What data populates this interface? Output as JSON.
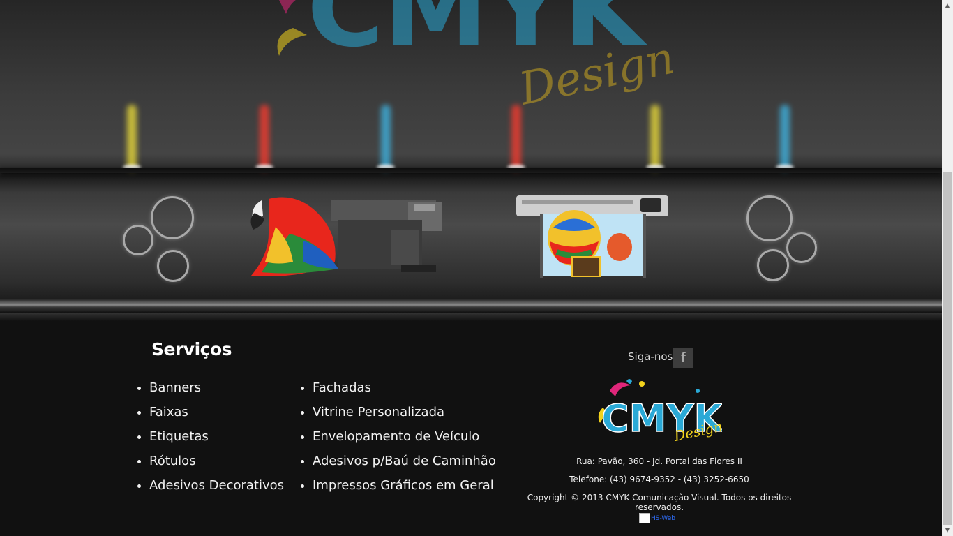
{
  "brand": {
    "wall_logo_text": "CMYK",
    "wall_logo_sub": "Design"
  },
  "services": {
    "title": "Serviços",
    "column1": [
      "Banners",
      "Faixas",
      "Etiquetas",
      "Rótulos",
      "Adesivos Decorativos"
    ],
    "column2": [
      "Fachadas",
      "Vitrine Personalizada",
      "Envelopamento de Veículo",
      "Adesivos p/Baú de Caminhão",
      "Impressos Gráficos em Geral"
    ]
  },
  "social": {
    "label": "Siga-nos",
    "icon": "facebook-icon",
    "icon_glyph": "f"
  },
  "contact": {
    "logo_text": "CMYK",
    "logo_sub": "Design",
    "address": "Rua: Pavão, 360 - Jd. Portal das Flores II",
    "phone": "Telefone: (43) 9674-9352 - (43) 3252-6650",
    "copyright": "Copyright © 2013 CMYK Comunicação Visual. Todos os direitos reservados."
  },
  "badge": {
    "alt": "HS-Web"
  },
  "colors": {
    "cyan": "#2aa9d6",
    "magenta": "#e0267a",
    "yellow": "#f2d21c",
    "key": "#444444"
  }
}
